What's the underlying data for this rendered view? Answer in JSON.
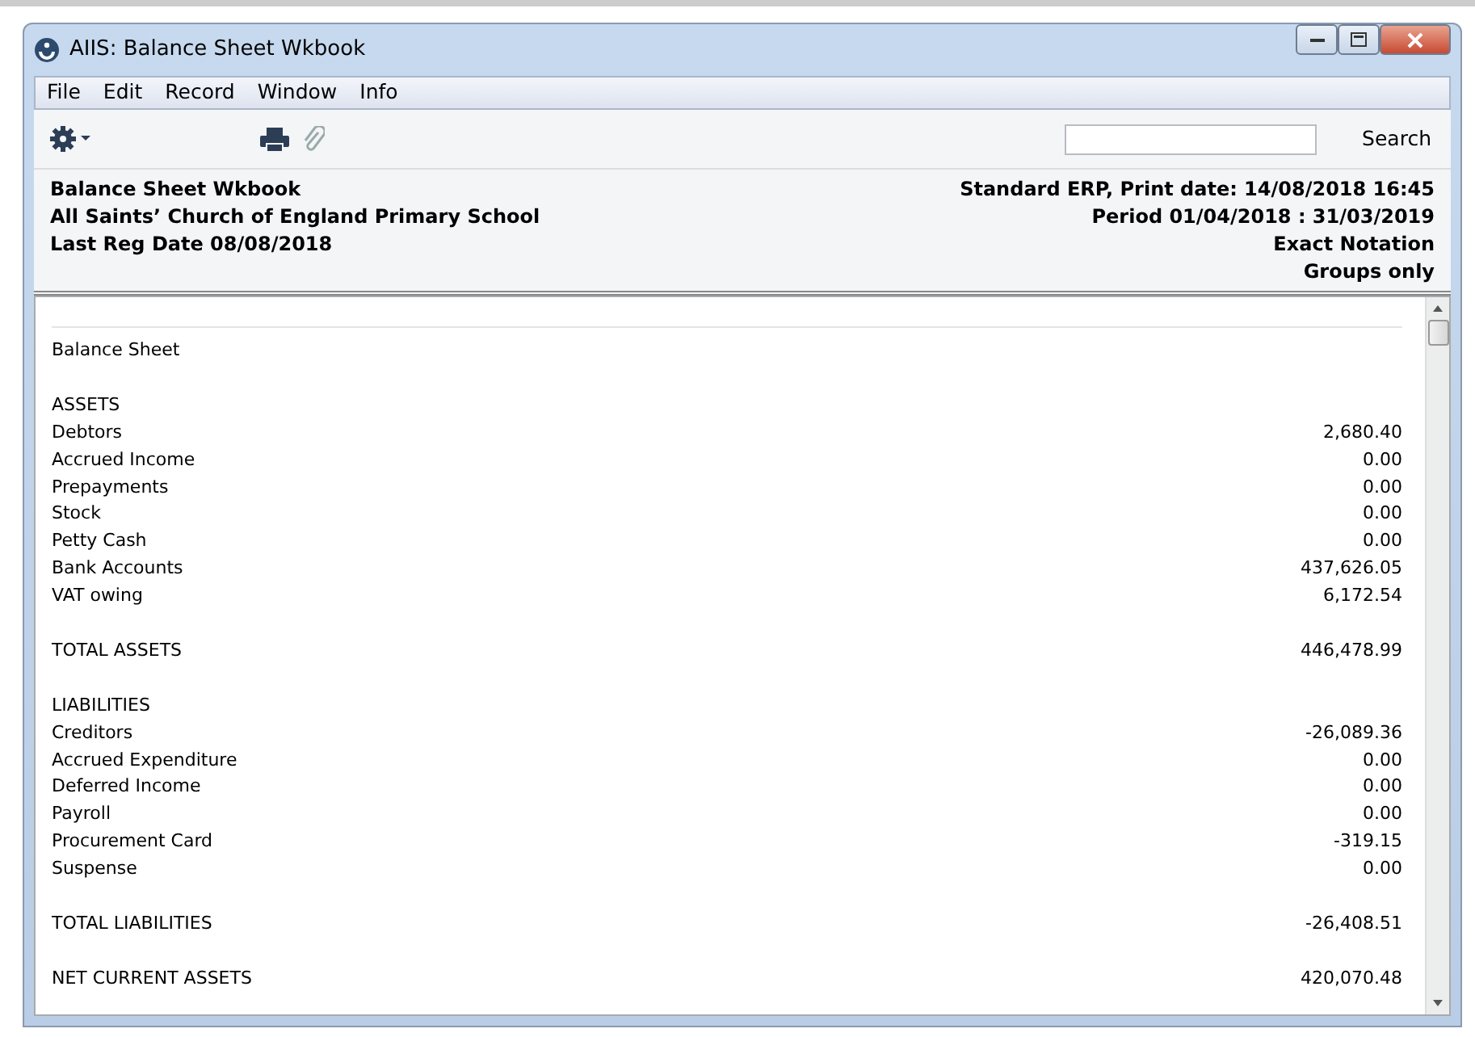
{
  "window": {
    "title": "AIIS: Balance Sheet Wkbook"
  },
  "menu": [
    "File",
    "Edit",
    "Record",
    "Window",
    "Info"
  ],
  "toolbar": {
    "search_button": "Search"
  },
  "header": {
    "left": [
      "Balance Sheet Wkbook",
      "All Saints’ Church of England Primary School",
      "Last Reg Date  08/08/2018"
    ],
    "right": [
      "Standard ERP, Print date: 14/08/2018 16:45",
      "Period  01/04/2018 : 31/03/2019",
      "Exact Notation",
      "Groups only"
    ]
  },
  "report": {
    "title": "Balance Sheet",
    "rows": [
      {
        "label": "ASSETS",
        "gap_before": true
      },
      {
        "label": "Debtors",
        "value": "2,680.40"
      },
      {
        "label": "Accrued Income",
        "value": "0.00"
      },
      {
        "label": "Prepayments",
        "value": "0.00"
      },
      {
        "label": "Stock",
        "value": "0.00"
      },
      {
        "label": "Petty Cash",
        "value": "0.00"
      },
      {
        "label": "Bank Accounts",
        "value": "437,626.05"
      },
      {
        "label": "VAT owing",
        "value": "6,172.54"
      },
      {
        "label": "TOTAL ASSETS",
        "value": "446,478.99",
        "gap_before": true
      },
      {
        "label": "LIABILITIES",
        "gap_before": true
      },
      {
        "label": "Creditors",
        "value": "-26,089.36"
      },
      {
        "label": "Accrued Expenditure",
        "value": "0.00"
      },
      {
        "label": "Deferred Income",
        "value": "0.00"
      },
      {
        "label": "Payroll",
        "value": "0.00"
      },
      {
        "label": "Procurement Card",
        "value": "-319.15"
      },
      {
        "label": "Suspense",
        "value": "0.00"
      },
      {
        "label": "TOTAL LIABILITIES",
        "value": "-26,408.51",
        "gap_before": true
      },
      {
        "label": "NET CURRENT ASSETS",
        "value": "420,070.48",
        "gap_before": true
      }
    ]
  }
}
